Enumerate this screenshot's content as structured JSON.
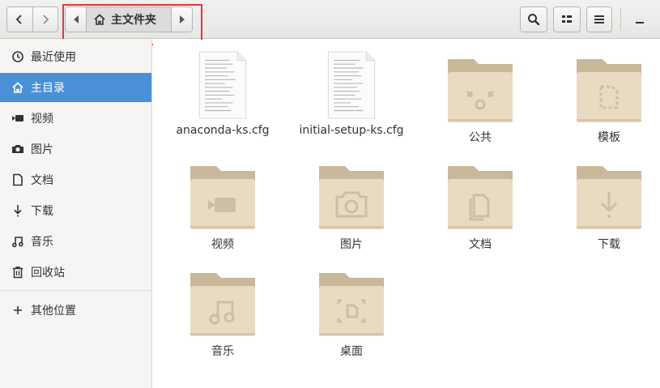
{
  "header": {
    "back_icon": "chevron-left-icon",
    "forward_icon": "chevron-right-icon",
    "path": {
      "home_label": "主文件夹"
    },
    "buttons": [
      "search-icon",
      "view-grid-icon",
      "menu-icon",
      "minimize-icon"
    ]
  },
  "sidebar": {
    "items": [
      {
        "label": "最近使用",
        "icon": "clock-icon"
      },
      {
        "label": "主目录",
        "icon": "home-icon",
        "active": true
      },
      {
        "label": "视频",
        "icon": "video-icon"
      },
      {
        "label": "图片",
        "icon": "camera-icon"
      },
      {
        "label": "文档",
        "icon": "document-icon"
      },
      {
        "label": "下载",
        "icon": "download-icon"
      },
      {
        "label": "音乐",
        "icon": "music-icon"
      },
      {
        "label": "回收站",
        "icon": "trash-icon"
      },
      {
        "label": "其他位置",
        "icon": "plus-icon"
      }
    ]
  },
  "files": [
    {
      "name": "anaconda-ks.cfg",
      "type": "text-file"
    },
    {
      "name": "initial-setup-ks.cfg",
      "type": "text-file"
    },
    {
      "name": "公共",
      "type": "folder-share"
    },
    {
      "name": "模板",
      "type": "folder-template"
    },
    {
      "name": "视频",
      "type": "folder-video"
    },
    {
      "name": "图片",
      "type": "folder-pictures"
    },
    {
      "name": "文档",
      "type": "folder-documents"
    },
    {
      "name": "下载",
      "type": "folder-download"
    },
    {
      "name": "音乐",
      "type": "folder-music"
    },
    {
      "name": "桌面",
      "type": "folder-desktop"
    }
  ],
  "colors": {
    "accent": "#4a90d9",
    "folder_back": "#c9b99a",
    "folder_front": "#e8dbc2",
    "folder_glyph": "#cdbfa5",
    "highlight": "#e0383b"
  }
}
